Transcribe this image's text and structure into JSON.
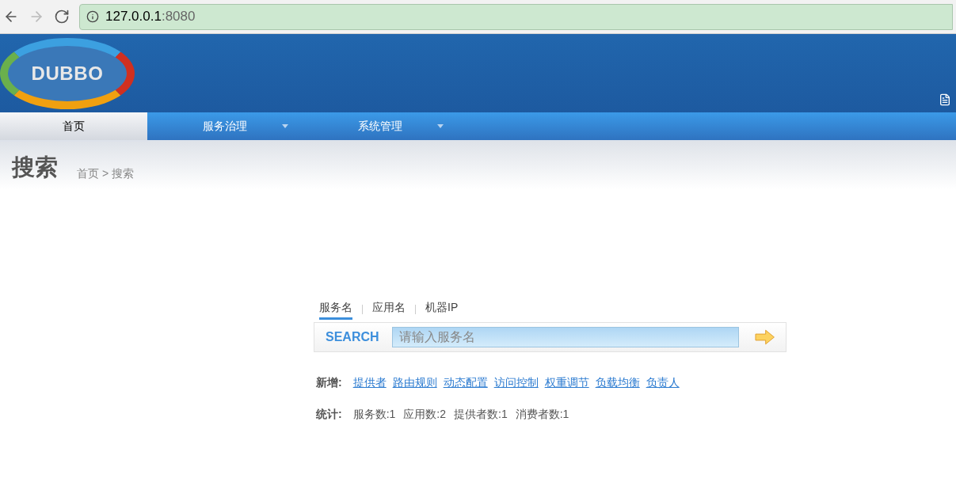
{
  "browser": {
    "url_host": "127.0.0.1",
    "url_port": ":8080"
  },
  "header": {
    "logo": "DUBBO"
  },
  "nav": [
    {
      "label": "首页",
      "selected": true,
      "dropdown": false
    },
    {
      "label": "服务治理",
      "selected": false,
      "dropdown": true
    },
    {
      "label": "系统管理",
      "selected": false,
      "dropdown": true
    }
  ],
  "page": {
    "title": "搜索",
    "breadcrumb": "首页 > 搜索"
  },
  "search": {
    "tabs": [
      {
        "label": "服务名",
        "selected": true
      },
      {
        "label": "应用名",
        "selected": false
      },
      {
        "label": "机器IP",
        "selected": false
      }
    ],
    "label": "SEARCH",
    "placeholder": "请输入服务名"
  },
  "add": {
    "label": "新增:",
    "links": [
      "提供者",
      "路由规则",
      "动态配置",
      "访问控制",
      "权重调节",
      "负载均衡",
      "负责人"
    ]
  },
  "stats": {
    "label": "统计:",
    "items": [
      "服务数:1",
      "应用数:2",
      "提供者数:1",
      "消费者数:1"
    ]
  }
}
